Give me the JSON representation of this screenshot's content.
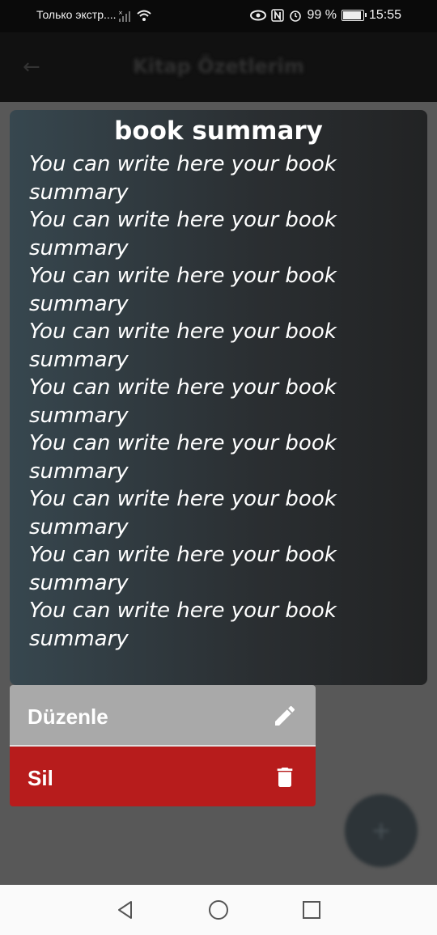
{
  "status_bar": {
    "carrier": "Только экстр....",
    "battery": "99 %",
    "time": "15:55"
  },
  "app_bar": {
    "title": "Kitap Özetlerim"
  },
  "summary_card": {
    "title": "book summary",
    "body": "You can write here your book\nsummary\nYou can write here your book\nsummary\nYou can write here your book\nsummary\nYou can write here your book\nsummary\nYou can write here your book\nsummary\nYou can write here your book\nsummary\nYou can write here your book\nsummary\nYou can write here your book\nsummary\nYou can write here your book\nsummary"
  },
  "menu": {
    "edit_label": "Düzenle",
    "delete_label": "Sil",
    "edit_icon": "pencil-icon",
    "delete_icon": "trash-icon",
    "edit_color": "#a9a9a9",
    "delete_color": "#b71c1c"
  },
  "fab": {
    "icon": "plus-icon",
    "label": "+"
  },
  "nav_bar": {
    "back_icon": "back-triangle-icon",
    "home_icon": "home-circle-icon",
    "recents_icon": "recents-square-icon"
  }
}
